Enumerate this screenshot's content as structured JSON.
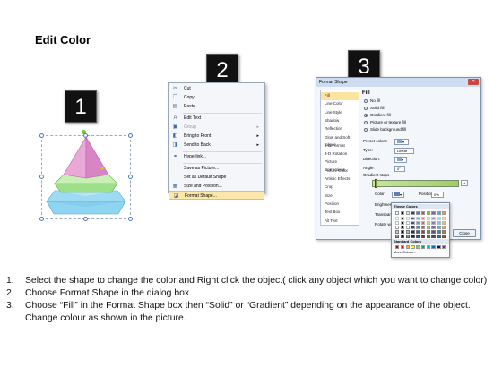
{
  "title": "Edit Color",
  "steps": {
    "s1": "1",
    "s2": "2",
    "s3": "3"
  },
  "context_menu": {
    "items": [
      {
        "label": "Cut",
        "icon": "scissors-icon",
        "glyph": "✂"
      },
      {
        "label": "Copy",
        "icon": "copy-icon",
        "glyph": "❐"
      },
      {
        "label": "Paste",
        "icon": "paste-icon",
        "glyph": "▤"
      },
      {
        "label": "Edit Text",
        "icon": "edit-text-icon",
        "glyph": "A"
      },
      {
        "label": "Group",
        "icon": "group-icon",
        "glyph": "▣",
        "disabled": true,
        "submenu": true
      },
      {
        "label": "Bring to Front",
        "icon": "bring-front-icon",
        "glyph": "◧",
        "submenu": true
      },
      {
        "label": "Send to Back",
        "icon": "send-back-icon",
        "glyph": "◨",
        "submenu": true
      },
      {
        "label": "Hyperlink...",
        "icon": "hyperlink-icon",
        "glyph": "⚭"
      },
      {
        "label": "Save as Picture...",
        "icon": "",
        "glyph": ""
      },
      {
        "label": "Set as Default Shape",
        "icon": "",
        "glyph": ""
      },
      {
        "label": "Size and Position...",
        "icon": "size-position-icon",
        "glyph": "▦"
      },
      {
        "label": "Format Shape...",
        "icon": "format-shape-icon",
        "glyph": "◪",
        "highlighted": true
      }
    ]
  },
  "dialog": {
    "title": "Format Shape",
    "close_glyph": "✕",
    "nav": [
      "Fill",
      "Line Color",
      "Line Style",
      "Shadow",
      "Reflection",
      "Glow and Soft Edges",
      "3-D Format",
      "3-D Rotation",
      "Picture Corrections",
      "Picture Color",
      "Artistic Effects",
      "Crop",
      "Size",
      "Position",
      "Text Box",
      "Alt Text"
    ],
    "pane_title": "Fill",
    "fill_options": [
      "No fill",
      "Solid fill",
      "Gradient fill",
      "Picture or texture fill",
      "Slide background fill"
    ],
    "selected_fill": "Gradient fill",
    "labels": {
      "preset": "Preset colors:",
      "type": "Type:",
      "type_value": "Linear",
      "direction": "Direction:",
      "angle": "Angle:",
      "angle_value": "0°",
      "gradient_stops": "Gradient stops",
      "color": "Color",
      "position": "Position:",
      "position_value": "0%",
      "brightness": "Brightness",
      "transparency": "Transparency",
      "rotate": "Rotate w"
    },
    "close_button": "Close"
  },
  "palette": {
    "theme_label": "Theme Colors",
    "standard_label": "Standard Colors",
    "more_label": "More Colors...",
    "theme_top": [
      "#ffffff",
      "#000000",
      "#eeece1",
      "#1f497d",
      "#4f81bd",
      "#c0504d",
      "#9bbb59",
      "#8064a2",
      "#4bacc6",
      "#f79646"
    ],
    "standard": [
      "#c00000",
      "#ff0000",
      "#ffc000",
      "#ffff00",
      "#92d050",
      "#00b050",
      "#00b0f0",
      "#0070c0",
      "#002060",
      "#7030a0"
    ]
  },
  "instructions": [
    {
      "num": "1.",
      "text": "Select the shape to change the color and Right click the object( click any object which you want to change color)"
    },
    {
      "num": "2.",
      "text": "Choose Format Shape in the dialog box."
    },
    {
      "num": "3.",
      "text": "Choose “Fill” in the Format Shape box then “Solid” or “Gradient” depending on the appearance of the object. Change colour as shown in the picture."
    }
  ]
}
